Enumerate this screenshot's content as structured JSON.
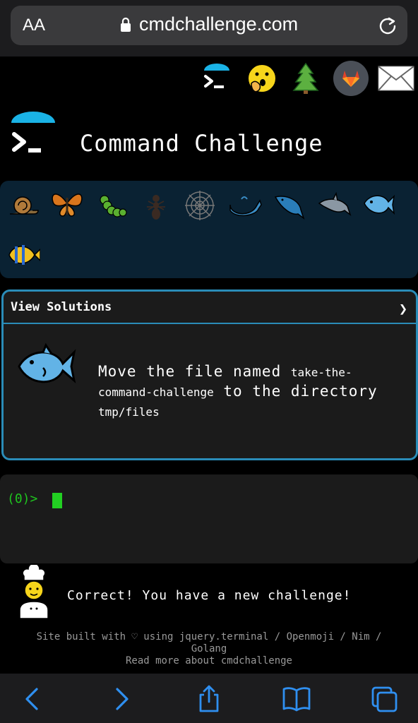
{
  "browser": {
    "text_size_label": "AA",
    "url": "cmdchallenge.com"
  },
  "header_icons": [
    "terminal-icon",
    "hand-over-mouth-emoji-icon",
    "tree-icon",
    "gitlab-icon",
    "mail-icon"
  ],
  "brand": {
    "title": "Command Challenge"
  },
  "levels": [
    "snail",
    "butterfly",
    "caterpillar",
    "ant",
    "spider-web",
    "whale",
    "spouting-whale",
    "dolphin",
    "fish",
    "tropical-fish"
  ],
  "challenge": {
    "view_solutions_label": "View Solutions",
    "chevron": "❯",
    "text_before": "Move the file named ",
    "filename": "take-the-command-challenge",
    "text_middle": " to the directory ",
    "directory": "tmp/files"
  },
  "terminal": {
    "prompt": "(0)> "
  },
  "feedback": {
    "message": "Correct! You have a new challenge!"
  },
  "footer": {
    "line1": "Site built with ♡ using jquery.terminal / Openmoji / Nim /",
    "line2": "Golang",
    "line3": "Read more about cmdchallenge"
  },
  "colors": {
    "accent": "#2a8cb8",
    "prompt_green": "#1fc51f",
    "browser_blue": "#2f8ff0"
  }
}
